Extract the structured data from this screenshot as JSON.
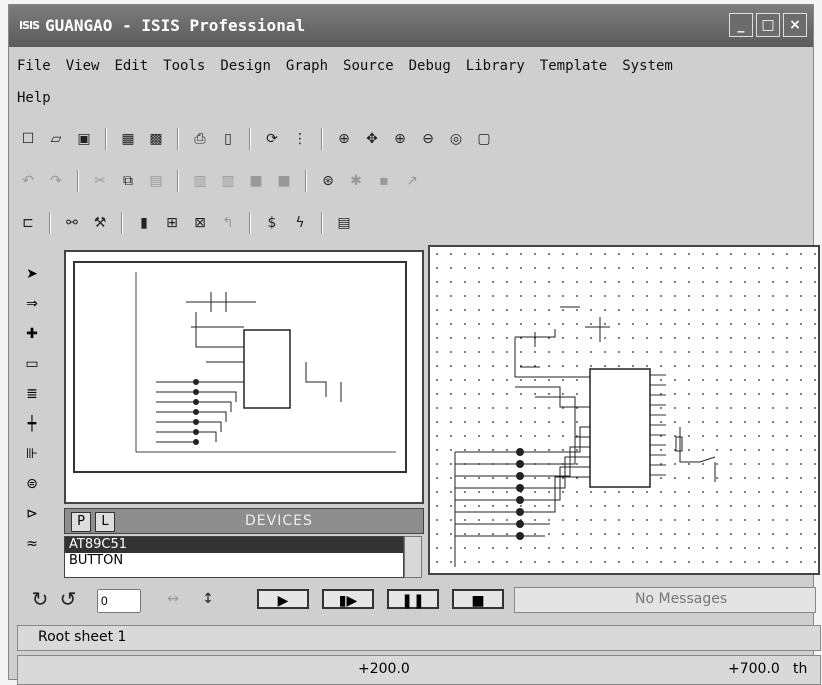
{
  "window": {
    "title": "GUANGAO - ISIS Professional",
    "app_icon": "ISIS",
    "controls": [
      "minimize",
      "maximize",
      "close"
    ]
  },
  "menu": {
    "row1": [
      "File",
      "View",
      "Edit",
      "Tools",
      "Design",
      "Graph",
      "Source",
      "Debug",
      "Library",
      "Template",
      "System"
    ],
    "row2": [
      "Help"
    ]
  },
  "devices": {
    "tabs": [
      "P",
      "L"
    ],
    "title": "DEVICES",
    "items": [
      "AT89C51",
      "BUTTON"
    ],
    "selected_index": 0
  },
  "sim": {
    "rotation_value": "0",
    "message": "No Messages"
  },
  "sheet": {
    "name": "Root sheet 1"
  },
  "status": {
    "x": "+200.0",
    "y": "+700.0",
    "unit": "th"
  },
  "icons": {
    "toolbar1": [
      "new-icon",
      "open-icon",
      "save-icon",
      "import-icon",
      "export-icon",
      "print-icon",
      "print-area-icon",
      "refresh-icon",
      "grid-icon",
      "origin-icon",
      "pan-icon",
      "zoom-in-icon",
      "zoom-out-icon",
      "zoom-all-icon",
      "zoom-area-icon"
    ],
    "toolbar2": [
      "undo-icon",
      "redo-icon",
      "cut-icon",
      "copy-icon",
      "paste-icon",
      "block-copy-icon",
      "block-move-icon",
      "block-rotate-icon",
      "block-delete-icon",
      "pick-device-icon",
      "make-device-icon",
      "package-icon",
      "decompose-icon"
    ],
    "toolbar3": [
      "wire-autorouter-icon",
      "search-icon",
      "property-tool-icon",
      "design-explorer-icon",
      "new-sheet-icon",
      "remove-sheet-icon",
      "exit-parent-icon",
      "bom-icon",
      "netlist-icon",
      "ares-icon"
    ],
    "left": [
      "select-icon",
      "component-icon",
      "junction-icon",
      "wire-label-icon",
      "text-script-icon",
      "bus-icon",
      "subcircuit-icon",
      "terminal-icon",
      "device-pin-icon",
      "graph-icon"
    ]
  }
}
